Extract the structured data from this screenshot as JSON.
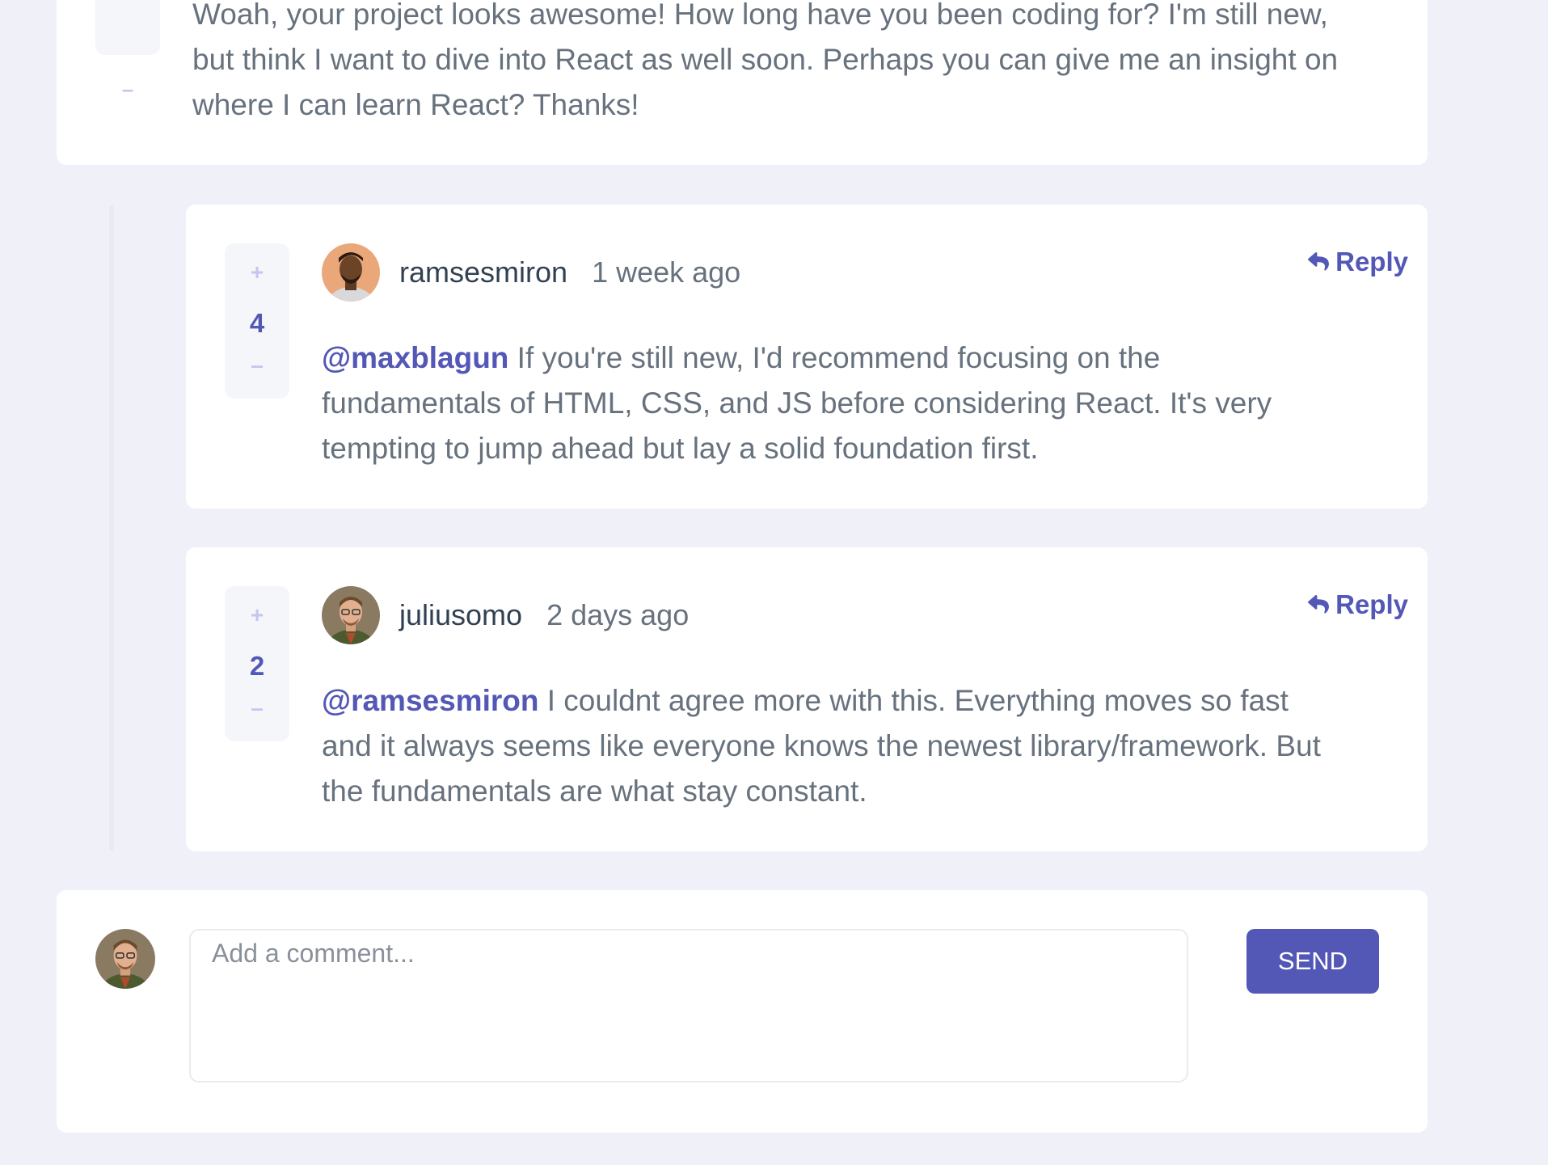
{
  "top_comment": {
    "text": "Woah, your project looks awesome! How long have you been coding for? I'm still new, but think I want to dive into React as well soon. Perhaps you can give me an insight on where I can learn React? Thanks!",
    "minus_symbol": "–"
  },
  "replies": [
    {
      "username": "ramsesmiron",
      "time": "1 week ago",
      "score": "4",
      "plus_symbol": "+",
      "minus_symbol": "–",
      "reply_label": "Reply",
      "mention": "@maxblagun",
      "text": " If you're still new, I'd recommend focusing on the fundamentals of HTML, CSS, and JS before considering React. It's very tempting to jump ahead but lay a solid foundation first."
    },
    {
      "username": "juliusomo",
      "time": "2 days ago",
      "score": "2",
      "plus_symbol": "+",
      "minus_symbol": "–",
      "reply_label": "Reply",
      "mention": "@ramsesmiron",
      "text": " I couldnt agree more with this. Everything moves so fast and it always seems like everyone knows the newest library/framework. But the fundamentals are what stay constant."
    }
  ],
  "add_comment": {
    "placeholder": "Add a comment...",
    "send_label": "SEND"
  },
  "colors": {
    "background": "#f0f0f9",
    "card": "#ffffff",
    "accent": "#5357b6",
    "muted_accent": "#c5c6ef",
    "text": "#67727e",
    "username": "#324152"
  },
  "icons": {
    "reply": "reply-arrow-icon",
    "avatar_ramses": "avatar-ramsesmiron",
    "avatar_julius": "avatar-juliusomo"
  }
}
